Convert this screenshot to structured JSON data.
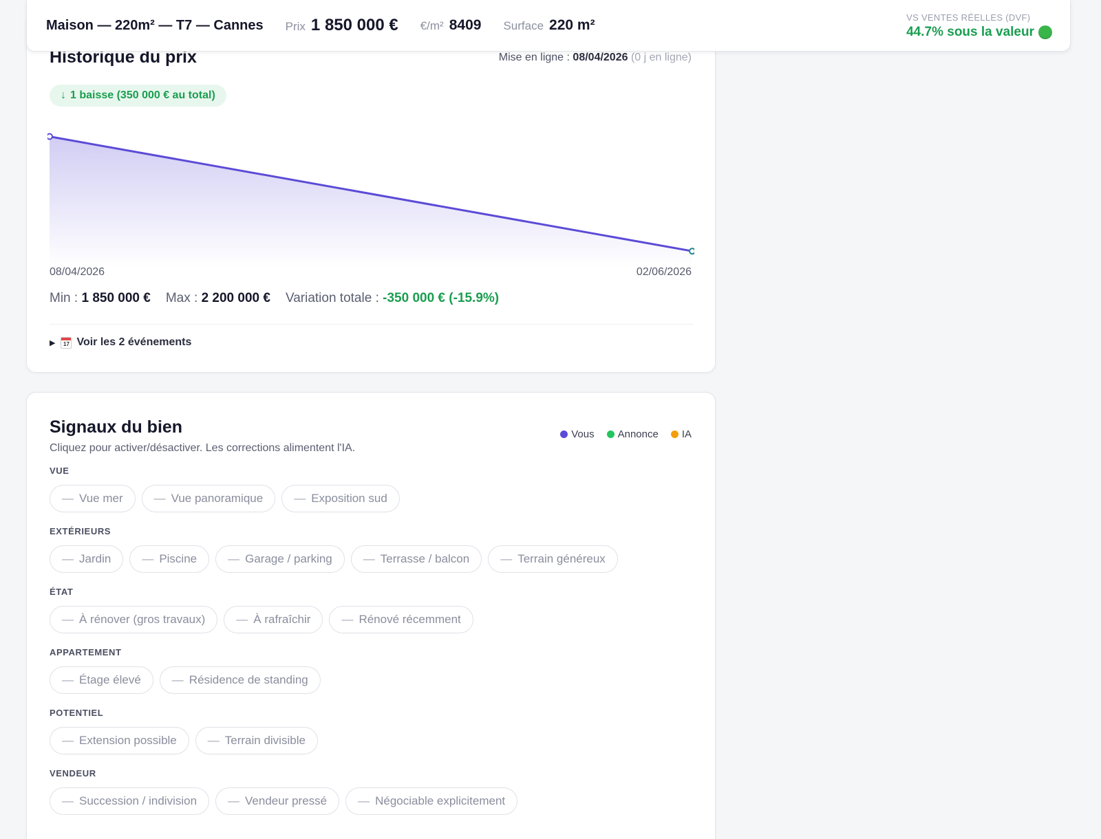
{
  "header": {
    "title": "Maison — 220m² — T7 — Cannes",
    "price_label": "Prix",
    "price_value": "1 850 000 €",
    "ppm_label": "€/m²",
    "ppm_value": "8409",
    "surface_label": "Surface",
    "surface_value": "220 m²",
    "dvf_label": "VS VENTES RÉELLES (DVF)",
    "dvf_value": "44.7% sous la valeur",
    "dvf_color": "#1a9e50"
  },
  "history": {
    "title": "Historique du prix",
    "online_label": "Mise en ligne :",
    "online_date": "08/04/2026",
    "online_days": "(0 j en ligne)",
    "drop_badge": "1 baisse (350 000 € au total)",
    "min_label": "Min :",
    "min_value": "1 850 000 €",
    "max_label": "Max :",
    "max_value": "2 200 000 €",
    "variation_label": "Variation totale :",
    "variation_value": "-350 000 € (-15.9%)",
    "events_toggle": "Voir les 2 événements",
    "calendar_day": "17",
    "line_color": "#5b4bd6"
  },
  "chart_data": {
    "type": "area",
    "x": [
      "08/04/2026",
      "02/06/2026"
    ],
    "values": [
      2200000,
      1850000
    ],
    "ylim": [
      1800000,
      2220000
    ],
    "grid": false,
    "xlabel": "",
    "ylabel": ""
  },
  "signals": {
    "title": "Signaux du bien",
    "subtitle": "Cliquez pour activer/désactiver. Les corrections alimentent l'IA.",
    "legend": [
      {
        "label": "Vous",
        "color": "#5b4bd6"
      },
      {
        "label": "Annonce",
        "color": "#22c55e"
      },
      {
        "label": "IA",
        "color": "#f59e0b"
      }
    ],
    "groups": [
      {
        "label": "VUE",
        "chips": [
          "Vue mer",
          "Vue panoramique",
          "Exposition sud"
        ]
      },
      {
        "label": "EXTÉRIEURS",
        "chips": [
          "Jardin",
          "Piscine",
          "Garage / parking",
          "Terrasse / balcon",
          "Terrain généreux"
        ]
      },
      {
        "label": "ÉTAT",
        "chips": [
          "À rénover (gros travaux)",
          "À rafraîchir",
          "Rénové récemment"
        ]
      },
      {
        "label": "APPARTEMENT",
        "chips": [
          "Étage élevé",
          "Résidence de standing"
        ]
      },
      {
        "label": "POTENTIEL",
        "chips": [
          "Extension possible",
          "Terrain divisible"
        ]
      },
      {
        "label": "VENDEUR",
        "chips": [
          "Succession / indivision",
          "Vendeur pressé",
          "Négociable explicitement"
        ]
      }
    ]
  }
}
